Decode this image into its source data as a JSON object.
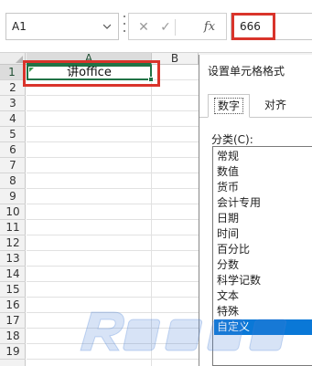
{
  "formula_bar": {
    "name_box": "A1",
    "cancel_icon": "✕",
    "confirm_icon": "✓",
    "fx_label": "fx",
    "formula_value": "666"
  },
  "sheet": {
    "columns": [
      "A",
      "B",
      "C"
    ],
    "rows": [
      "1",
      "2",
      "3",
      "4",
      "5",
      "6",
      "7",
      "8",
      "9",
      "10",
      "11",
      "12",
      "13",
      "14",
      "15",
      "16",
      "17",
      "18",
      "19"
    ],
    "cell_a1": "讲office"
  },
  "dialog": {
    "title": "设置单元格格式",
    "tabs": [
      "数字",
      "对齐"
    ],
    "category_label": "分类(C):",
    "categories": [
      "常规",
      "数值",
      "货币",
      "会计专用",
      "日期",
      "时间",
      "百分比",
      "分数",
      "科学记数",
      "文本",
      "特殊",
      "自定义"
    ],
    "selected_index": 11
  },
  "colors": {
    "highlight_red": "#d9342b",
    "excel_green": "#217346",
    "selection_blue": "#0a78d7"
  }
}
